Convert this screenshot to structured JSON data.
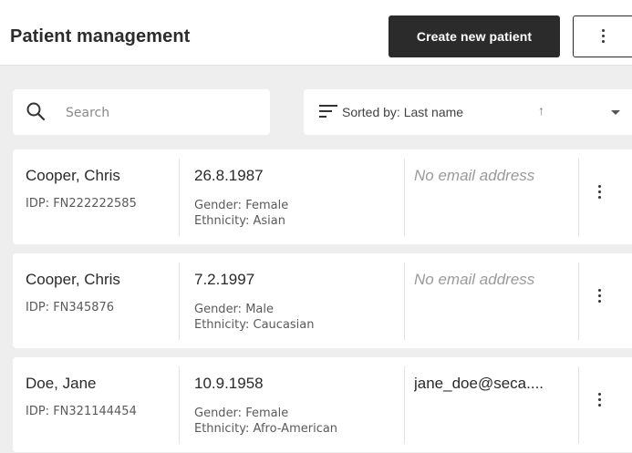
{
  "header": {
    "title": "Patient management",
    "create_button": "Create new patient"
  },
  "search": {
    "placeholder": "Search"
  },
  "sort": {
    "label": "Sorted by:",
    "field": "Last name",
    "direction_icon": "↑",
    "text": "Sorted by:  Last name"
  },
  "patients": [
    {
      "name": "Cooper, Chris",
      "idp": "IDP: FN222222585",
      "dob": "26.8.1987",
      "gender": "Gender: Female",
      "ethnicity": "Ethnicity: Asian",
      "email": "No email address"
    },
    {
      "name": "Cooper, Chris",
      "idp": "IDP: FN345876",
      "dob": "7.2.1997",
      "gender": "Gender: Male",
      "ethnicity": "Ethnicity: Caucasian",
      "email": "No email address"
    },
    {
      "name": "Doe, Jane",
      "idp": "IDP: FN321144454",
      "dob": "10.9.1958",
      "gender": "Gender: Female",
      "ethnicity": "Ethnicity: Afro-American",
      "email": "jane_doe@seca...."
    }
  ],
  "icons": {
    "search": "search-icon",
    "sort": "sort-icon",
    "more": "more-vert-icon",
    "dropdown": "chevron-down-icon"
  },
  "colors": {
    "primary_button": "#2b2b2b",
    "background": "#eeeeee",
    "surface": "#ffffff"
  }
}
